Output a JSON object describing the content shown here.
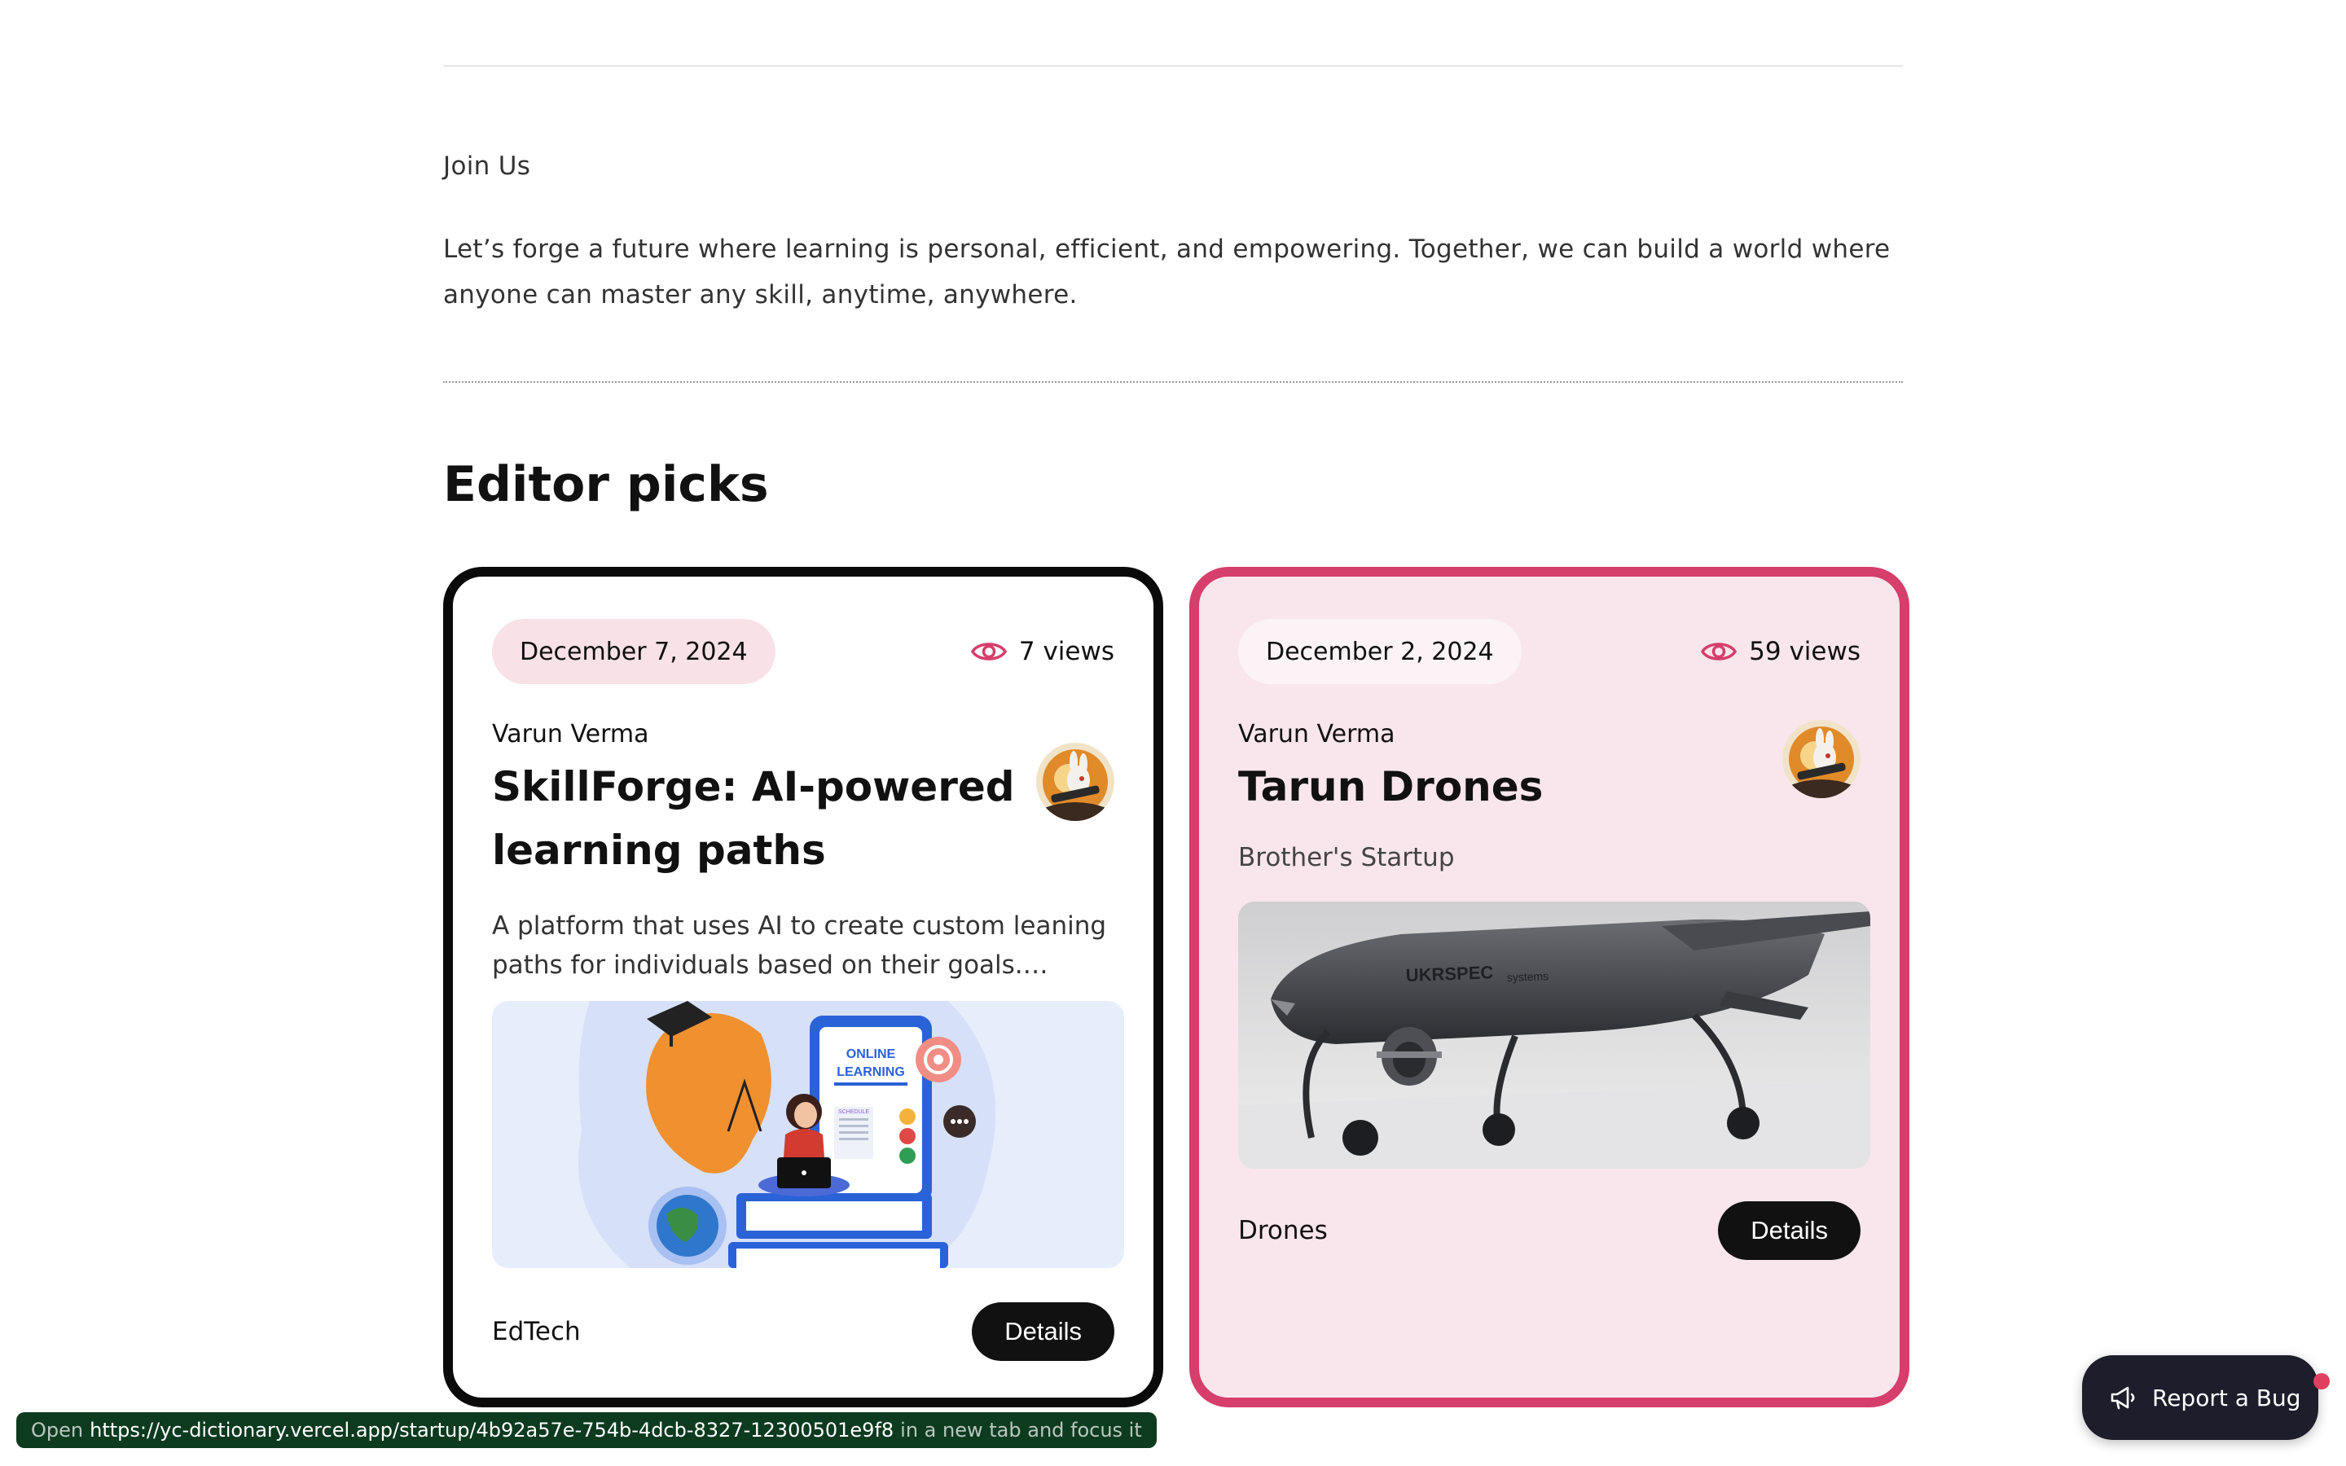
{
  "join": {
    "title": "Join Us",
    "text": "Let’s forge a future where learning is personal, efficient, and empowering. Together, we can build a world where anyone can master any skill, anytime, anywhere."
  },
  "editor_picks": {
    "title": "Editor picks",
    "cards": [
      {
        "date": "December 7, 2024",
        "views": "7 views",
        "author": "Varun Verma",
        "title": "SkillForge: AI-powered learning paths",
        "description": "A platform that uses AI to create custom leaning paths for individuals based on their goals. learn...",
        "image_labels": [
          "ONLINE",
          "LEARNING",
          "SCHEDULE"
        ],
        "category": "EdTech",
        "details_label": "Details"
      },
      {
        "date": "December 2, 2024",
        "views": "59 views",
        "author": "Varun Verma",
        "title": "Tarun Drones",
        "subtitle": "Brother's Startup",
        "image_labels": [
          "UKRSPEC",
          "systems"
        ],
        "category": "Drones",
        "details_label": "Details"
      }
    ]
  },
  "status_bar": {
    "prefix": "Open",
    "url": "https://yc-dictionary.vercel.app/startup/4b92a57e-754b-4dcb-8327-12300501e9f8",
    "suffix": "in a new tab and focus it"
  },
  "report_bug": {
    "label": "Report a Bug"
  },
  "colors": {
    "accent_pink": "#d63e6c",
    "card_pink_bg": "#f9e6ec",
    "button_dark": "#111111"
  },
  "icons": {
    "views": "eye-icon",
    "bug": "megaphone-icon"
  }
}
